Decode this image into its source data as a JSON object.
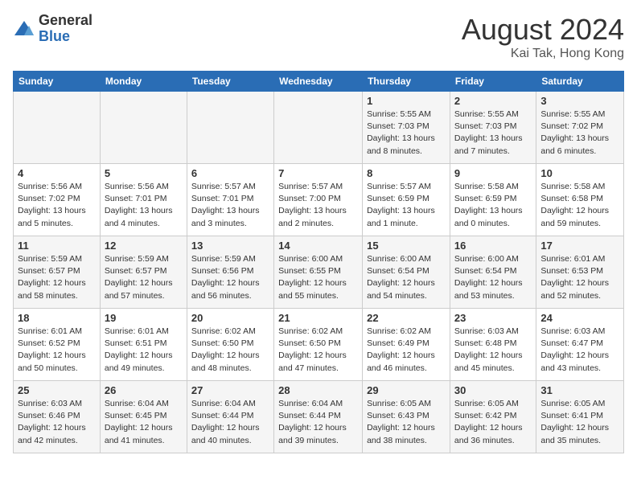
{
  "logo": {
    "general": "General",
    "blue": "Blue"
  },
  "title": "August 2024",
  "location": "Kai Tak, Hong Kong",
  "days_of_week": [
    "Sunday",
    "Monday",
    "Tuesday",
    "Wednesday",
    "Thursday",
    "Friday",
    "Saturday"
  ],
  "weeks": [
    [
      {
        "day": "",
        "info": ""
      },
      {
        "day": "",
        "info": ""
      },
      {
        "day": "",
        "info": ""
      },
      {
        "day": "",
        "info": ""
      },
      {
        "day": "1",
        "info": "Sunrise: 5:55 AM\nSunset: 7:03 PM\nDaylight: 13 hours\nand 8 minutes."
      },
      {
        "day": "2",
        "info": "Sunrise: 5:55 AM\nSunset: 7:03 PM\nDaylight: 13 hours\nand 7 minutes."
      },
      {
        "day": "3",
        "info": "Sunrise: 5:55 AM\nSunset: 7:02 PM\nDaylight: 13 hours\nand 6 minutes."
      }
    ],
    [
      {
        "day": "4",
        "info": "Sunrise: 5:56 AM\nSunset: 7:02 PM\nDaylight: 13 hours\nand 5 minutes."
      },
      {
        "day": "5",
        "info": "Sunrise: 5:56 AM\nSunset: 7:01 PM\nDaylight: 13 hours\nand 4 minutes."
      },
      {
        "day": "6",
        "info": "Sunrise: 5:57 AM\nSunset: 7:01 PM\nDaylight: 13 hours\nand 3 minutes."
      },
      {
        "day": "7",
        "info": "Sunrise: 5:57 AM\nSunset: 7:00 PM\nDaylight: 13 hours\nand 2 minutes."
      },
      {
        "day": "8",
        "info": "Sunrise: 5:57 AM\nSunset: 6:59 PM\nDaylight: 13 hours\nand 1 minute."
      },
      {
        "day": "9",
        "info": "Sunrise: 5:58 AM\nSunset: 6:59 PM\nDaylight: 13 hours\nand 0 minutes."
      },
      {
        "day": "10",
        "info": "Sunrise: 5:58 AM\nSunset: 6:58 PM\nDaylight: 12 hours\nand 59 minutes."
      }
    ],
    [
      {
        "day": "11",
        "info": "Sunrise: 5:59 AM\nSunset: 6:57 PM\nDaylight: 12 hours\nand 58 minutes."
      },
      {
        "day": "12",
        "info": "Sunrise: 5:59 AM\nSunset: 6:57 PM\nDaylight: 12 hours\nand 57 minutes."
      },
      {
        "day": "13",
        "info": "Sunrise: 5:59 AM\nSunset: 6:56 PM\nDaylight: 12 hours\nand 56 minutes."
      },
      {
        "day": "14",
        "info": "Sunrise: 6:00 AM\nSunset: 6:55 PM\nDaylight: 12 hours\nand 55 minutes."
      },
      {
        "day": "15",
        "info": "Sunrise: 6:00 AM\nSunset: 6:54 PM\nDaylight: 12 hours\nand 54 minutes."
      },
      {
        "day": "16",
        "info": "Sunrise: 6:00 AM\nSunset: 6:54 PM\nDaylight: 12 hours\nand 53 minutes."
      },
      {
        "day": "17",
        "info": "Sunrise: 6:01 AM\nSunset: 6:53 PM\nDaylight: 12 hours\nand 52 minutes."
      }
    ],
    [
      {
        "day": "18",
        "info": "Sunrise: 6:01 AM\nSunset: 6:52 PM\nDaylight: 12 hours\nand 50 minutes."
      },
      {
        "day": "19",
        "info": "Sunrise: 6:01 AM\nSunset: 6:51 PM\nDaylight: 12 hours\nand 49 minutes."
      },
      {
        "day": "20",
        "info": "Sunrise: 6:02 AM\nSunset: 6:50 PM\nDaylight: 12 hours\nand 48 minutes."
      },
      {
        "day": "21",
        "info": "Sunrise: 6:02 AM\nSunset: 6:50 PM\nDaylight: 12 hours\nand 47 minutes."
      },
      {
        "day": "22",
        "info": "Sunrise: 6:02 AM\nSunset: 6:49 PM\nDaylight: 12 hours\nand 46 minutes."
      },
      {
        "day": "23",
        "info": "Sunrise: 6:03 AM\nSunset: 6:48 PM\nDaylight: 12 hours\nand 45 minutes."
      },
      {
        "day": "24",
        "info": "Sunrise: 6:03 AM\nSunset: 6:47 PM\nDaylight: 12 hours\nand 43 minutes."
      }
    ],
    [
      {
        "day": "25",
        "info": "Sunrise: 6:03 AM\nSunset: 6:46 PM\nDaylight: 12 hours\nand 42 minutes."
      },
      {
        "day": "26",
        "info": "Sunrise: 6:04 AM\nSunset: 6:45 PM\nDaylight: 12 hours\nand 41 minutes."
      },
      {
        "day": "27",
        "info": "Sunrise: 6:04 AM\nSunset: 6:44 PM\nDaylight: 12 hours\nand 40 minutes."
      },
      {
        "day": "28",
        "info": "Sunrise: 6:04 AM\nSunset: 6:44 PM\nDaylight: 12 hours\nand 39 minutes."
      },
      {
        "day": "29",
        "info": "Sunrise: 6:05 AM\nSunset: 6:43 PM\nDaylight: 12 hours\nand 38 minutes."
      },
      {
        "day": "30",
        "info": "Sunrise: 6:05 AM\nSunset: 6:42 PM\nDaylight: 12 hours\nand 36 minutes."
      },
      {
        "day": "31",
        "info": "Sunrise: 6:05 AM\nSunset: 6:41 PM\nDaylight: 12 hours\nand 35 minutes."
      }
    ]
  ]
}
